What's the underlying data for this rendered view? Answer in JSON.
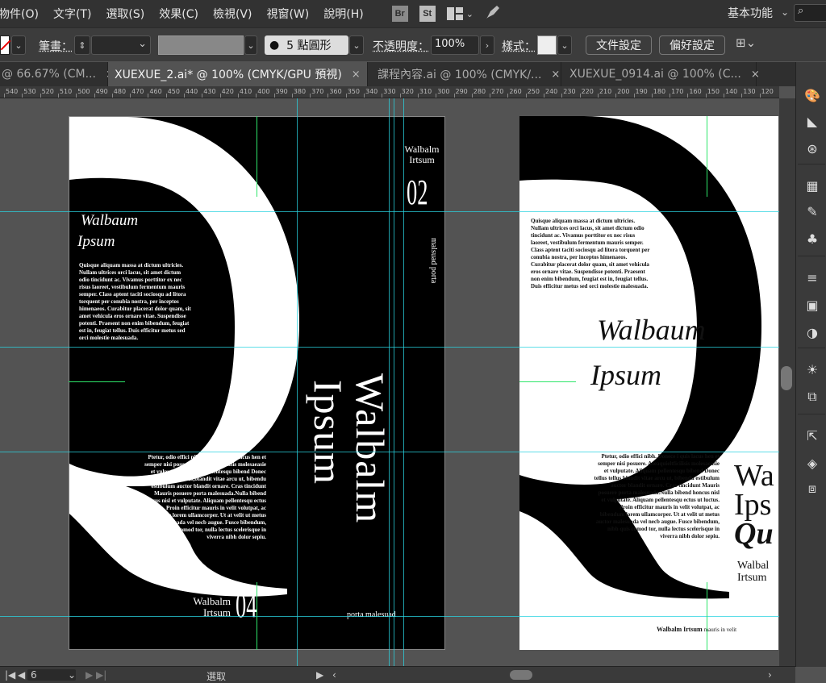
{
  "menu": [
    "物件(O)",
    "文字(T)",
    "選取(S)",
    "效果(C)",
    "檢視(V)",
    "視窗(W)",
    "說明(H)"
  ],
  "menu_icons": {
    "br": "Br",
    "st": "St",
    "layout": "layout-grid-icon",
    "rocket": "gpu-rocket-icon"
  },
  "workspace": "基本功能",
  "search_glyph": "⌕",
  "control": {
    "stroke_label": "筆畫：",
    "brush_value": "5 點圓形",
    "opacity_label": "不透明度：",
    "opacity_value": "100%",
    "style_label": "樣式：",
    "doc_setup": "文件設定",
    "preferences": "偏好設定"
  },
  "tabs": [
    {
      "label": "@ 66.67% (CM...",
      "close": "×"
    },
    {
      "label": "XUEXUE_2.ai* @ 100% (CMYK/GPU 預視)",
      "close": "×"
    },
    {
      "label": "課程內容.ai @ 100% (CMYK/...",
      "close": "×"
    },
    {
      "label": "XUEXUE_0914.ai @ 100% (C...",
      "close": "×"
    }
  ],
  "ruler_labels": [
    "540",
    "530",
    "520",
    "510",
    "500",
    "490",
    "480",
    "470",
    "460",
    "450",
    "440",
    "430",
    "420",
    "410",
    "400",
    "390",
    "380",
    "370",
    "360",
    "350",
    "340",
    "330",
    "320",
    "310",
    "300",
    "290",
    "280",
    "270",
    "260",
    "250",
    "240",
    "230",
    "220",
    "210",
    "200",
    "190",
    "180",
    "170",
    "160",
    "150",
    "140",
    "130",
    "120"
  ],
  "black_board": {
    "script_title_1": "Walbaum",
    "script_title_2": "Ipsum",
    "paragraph_1": "Quisque aliquam massa at dictum ultricies. Nullam ultrices orci lacus, sit amet dictum odio tincidunt ac. Vivamus porttitor ex nec risus laoreet, vestibulum fermentum mauris semper. Class aptent taciti sociosqu ad litora torquent per conubia nostra, per inceptos himenaeos. Curabitur placerat dolor quam, sit amet vehicula eros ornare vitae. Suspendisse potenti. Praesent non enim bibendum, feugiat est in, feugiat tellus. Duis efficitur metus sed orci molestie malesuada.",
    "paragraph_2": "Ptetur, odio effici nibh. Donece i quis lacus hen et semper nisi posuere. Aseaquieltficilisis molesaeasie et vulputate. Aliquam pellentesqu bibend Donec tellus tellus,blandit vitae arcu ut, bibendu estibulum auctor blandit ornare. Cras tincidunt Mauris posuere porta malesuada.Nulla bibend honcus nisl et vulputate. Aliquam pellentesqu ectus ut luctus. Proin efficitur mauris in velit volutpat, ac bibendum lorem ullamcorper. Ut at velit ut metus auctor malesuada vel necb augue. Fusce bibendum, nibh quis comod tor, nulla lectus scelerisque in viverra nibh dolor sepiu.",
    "spine_name_1": "Walbalm",
    "spine_name_2": "Irtsum",
    "spine_number": "02",
    "spine_vertical": "malsuad porta",
    "big_vertical_1": "Walbalm",
    "big_vertical_2": "Ipsum",
    "footer_name_1": "Walbalm",
    "footer_name_2": "Irtsum",
    "footer_number": "04",
    "footer_caption": "porta malesuad",
    "big_letter": "Q"
  },
  "white_board": {
    "paragraph_1": "Quisque aliquam massa at dictum ultricies. Nullam ultrices orci lacus, sit amet dictum odio tincidunt ac. Vivamus porttitor ex nec risus laoreet, vestibulum fermentum mauris semper. Class aptent taciti sociosqu ad litora torquent per conubia nostra, per inceptos himenaeos. Curabitur placerat dolor quam, sit amet vehicula eros ornare vitae. Suspendisse potenti. Praesent non enim bibendum, feugiat est in, feugiat tellus. Duis efficitur metus sed orci molestie malesuada.",
    "script_title_1": "Walbaum",
    "script_title_2": "Ipsum",
    "paragraph_2": "Ptetur, odio effici nibh. Donece i quis lacus hen et semper nisi posuere. Aseaquieltficilisis molesaeasie et vulputate. Aliquam pellentesqu bibend Donec tellus tellus,blandit vitae arcu ut, bibendu estibulum auctor blandit ornare. Cras tincidunt Mauris posuere porta malesuada.Nulla bibend honcus nisl et vulputate. Aliquam pellentesqu ectus ut luctus. Proin efficitur mauris in velit volutpat, ac bibendum lorem ullamcorper. Ut at velit ut metus auctor malesuada vel necb augue. Fusce bibendum, nibh quis comod tor, nulla lectus scelerisque in viverra nibh dolor sepiu.",
    "side_1": "Wa",
    "side_2": "Ips",
    "side_3": "Qu",
    "side_4": "Walbal",
    "side_5": "Irtsum",
    "footer_bold": "Walbalm Irtsum",
    "footer_small": "mauris in velit",
    "big_letter": "Q"
  },
  "status": {
    "zoom": "6",
    "mode": "選取"
  },
  "colors": {
    "guide": "#29d3e0",
    "guide_green": "#2ee56a",
    "artboard_black": "#000000",
    "artboard_white": "#ffffff"
  }
}
